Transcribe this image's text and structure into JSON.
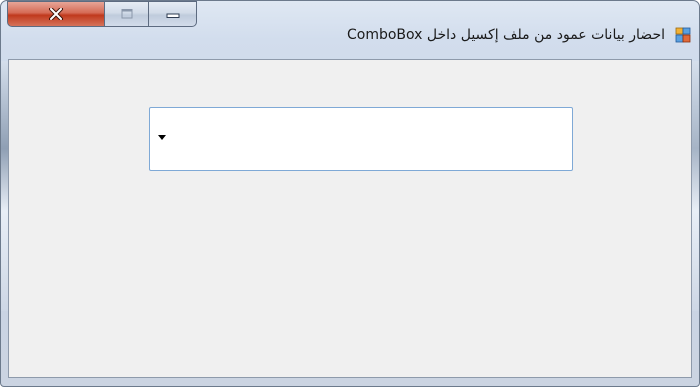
{
  "window": {
    "title": "احضار بيانات عمود من ملف إكسيل داخل ComboBox",
    "app_icon": "form-icon",
    "caption_buttons": {
      "close_icon": "close-icon",
      "restore_icon": "restore-icon",
      "minimize_icon": "minimize-icon"
    },
    "colors": {
      "close_button": "#c83c20",
      "client_background": "#f0f0f0",
      "combobox_border": "#7fa9d6"
    }
  },
  "combobox": {
    "selected_value": "",
    "arrow_icon": "dropdown-arrow-icon"
  }
}
